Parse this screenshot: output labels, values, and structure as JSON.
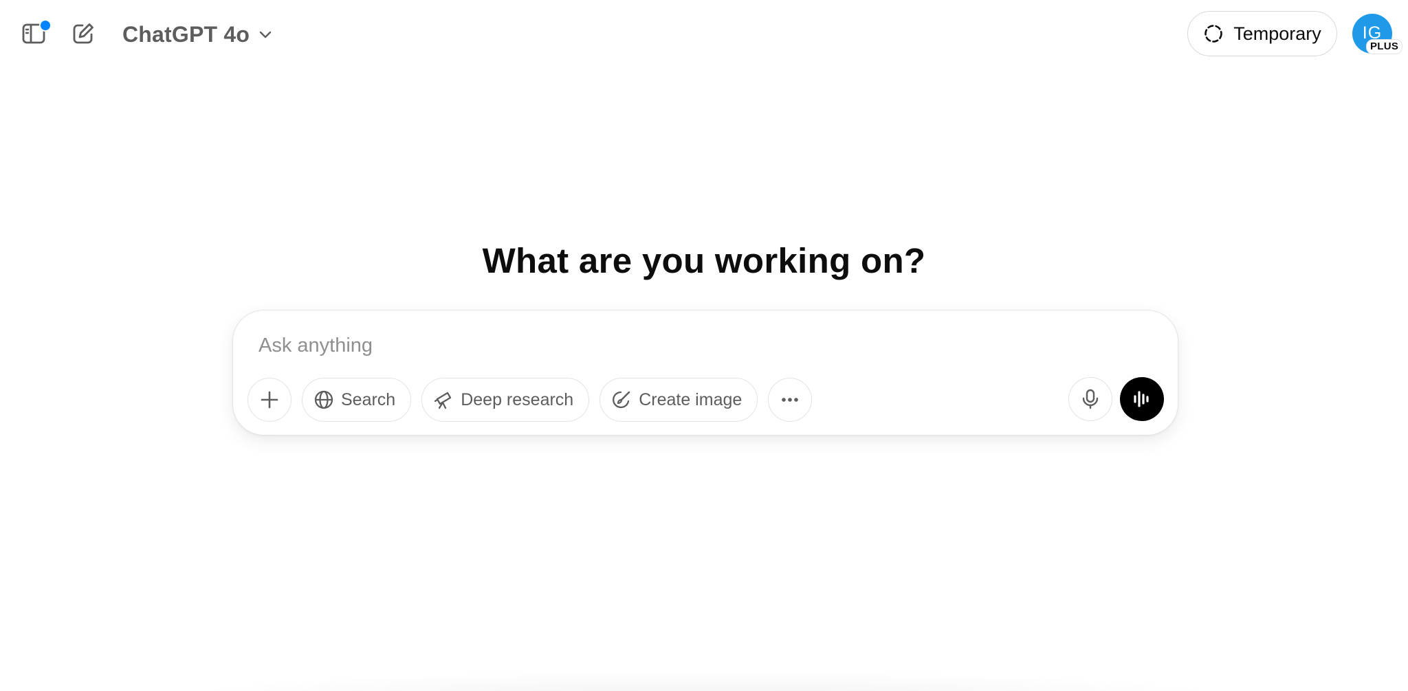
{
  "header": {
    "model_name": "ChatGPT 4o",
    "temporary_label": "Temporary",
    "avatar_initials": "IG",
    "plan_badge": "PLUS",
    "notification_color": "#0285ff",
    "avatar_color": "#1f9ae8"
  },
  "main": {
    "heading": "What are you working on?",
    "composer": {
      "placeholder": "Ask anything",
      "value": "",
      "tools": [
        {
          "label": "Search",
          "icon": "globe-icon"
        },
        {
          "label": "Deep research",
          "icon": "telescope-icon"
        },
        {
          "label": "Create image",
          "icon": "paintbrush-icon"
        }
      ],
      "attach_icon": "plus-icon",
      "more_icon": "ellipsis-icon",
      "mic_icon": "microphone-icon",
      "voice_icon": "voice-wave-icon"
    }
  }
}
